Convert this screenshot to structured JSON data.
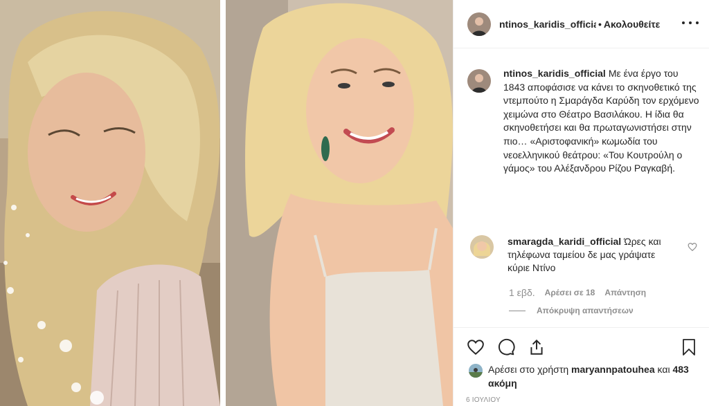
{
  "post": {
    "photo_alt": "Collage of two portrait photos of a blonde woman"
  },
  "header": {
    "username": "ntinos_karidis_official",
    "separator": "•",
    "follow_status": "Ακολουθείτε"
  },
  "caption": {
    "username": "ntinos_karidis_official",
    "text": "Με ένα έργο του 1843 αποφάσισε να κάνει το σκηνοθετικό της ντεμπούτο η Σμαράγδα Καρύδη τον ερχόμενο χειμώνα στο Θέατρο Βασιλάκου. Η ίδια θα σκηνοθετήσει και θα πρωταγωνιστήσει στην πιο… «Αριστοφανική» κωμωδία του νεοελληνικού θεάτρου: «Του Κουτρούλη ο γάμος» του Αλέξανδρου Ρίζου Ραγκαβή."
  },
  "comment": {
    "username": "smaragda_karidi_official",
    "text": "Ώρες και τηλέφωνα ταμείου δε μας γράψατε κύριε Ντίνο",
    "time": "1 εβδ.",
    "likes": "Αρέσει σε 18",
    "reply": "Απάντηση",
    "hide_replies": "Απόκρυψη απαντήσεων"
  },
  "likes": {
    "prefix": "Αρέσει στο χρήστη",
    "user": "maryannpatouhea",
    "middle": "και",
    "others": "483 ακόμη"
  },
  "date": "6 ΙΟΥΛΙΟΥ",
  "colors": {
    "text": "#262626",
    "secondary": "#8e8e8e",
    "border": "#efefef"
  }
}
